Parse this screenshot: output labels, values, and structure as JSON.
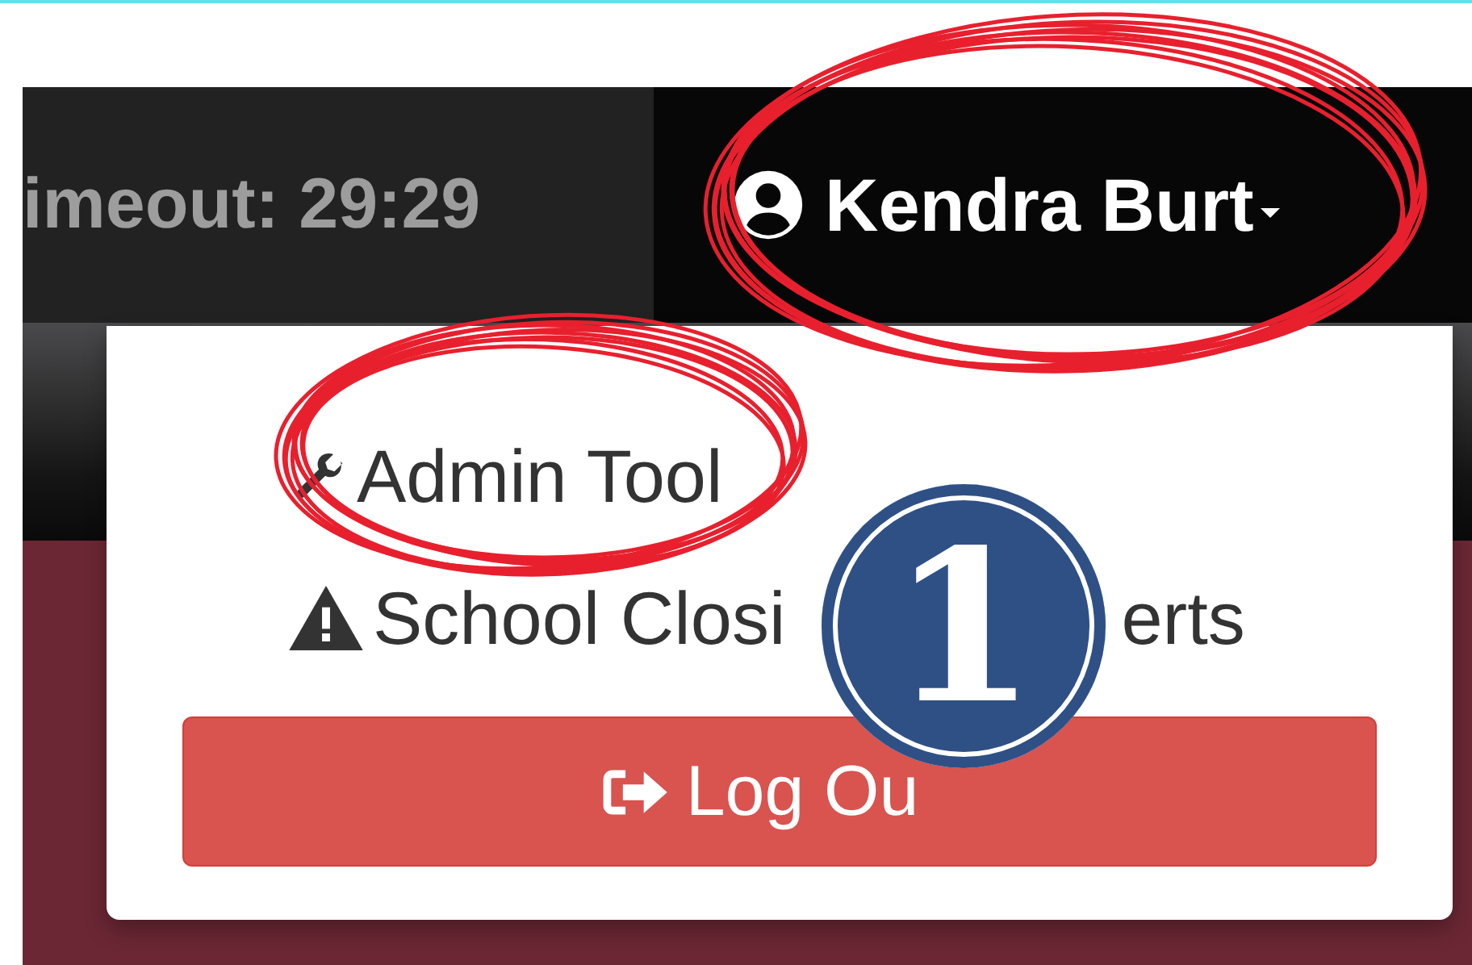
{
  "header": {
    "timeout": "imeout: 29:29",
    "user": "Kendra Burt"
  },
  "menu": {
    "items": [
      {
        "label": "Admin Tool"
      },
      {
        "label": "School Closi",
        "label_after_badge": "erts"
      }
    ],
    "logout": "Log Ou"
  },
  "annotation": {
    "badge": "1"
  }
}
